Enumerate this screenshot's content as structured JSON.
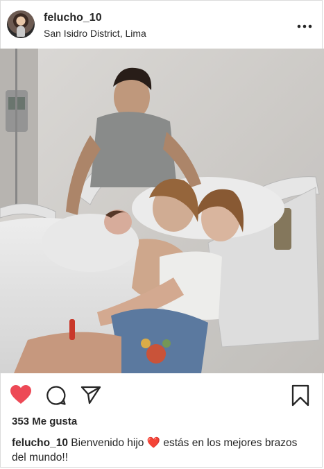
{
  "post": {
    "username": "felucho_10",
    "location": "San Isidro District, Lima",
    "likes_text": "353 Me gusta",
    "caption": {
      "username": "felucho_10",
      "text_before_emoji": "Bienvenido hijo",
      "emoji": "❤️",
      "text_after_emoji": "estás en los mejores brazos del mundo!!"
    }
  },
  "icons": {
    "like": "heart-icon-filled",
    "comment": "comment-icon",
    "share": "direct-share-icon",
    "save": "bookmark-icon",
    "options": "more-options-icon"
  },
  "colors": {
    "like_red": "#ed4956",
    "text": "#262626",
    "border": "#dbdbdb"
  }
}
